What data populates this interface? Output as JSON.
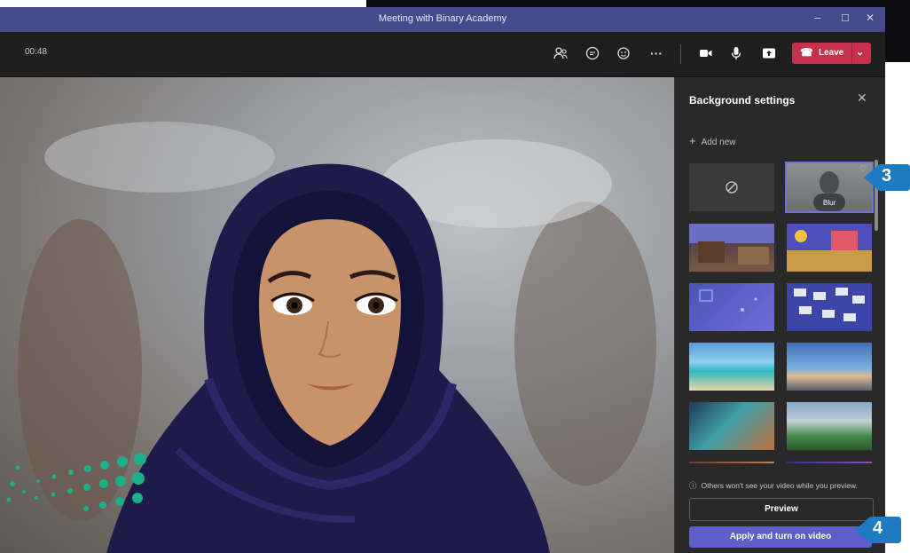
{
  "window": {
    "title": "Meeting with Binary Academy",
    "minimize": "–",
    "maximize": "☐",
    "close": "✕"
  },
  "toolbar": {
    "timer": "00:48",
    "leave_label": "Leave",
    "icons": [
      "people-icon",
      "chat-icon",
      "reactions-icon",
      "more-icon",
      "camera-icon",
      "mic-icon",
      "share-icon"
    ]
  },
  "panel": {
    "title": "Background settings",
    "add_new": "Add new",
    "blur_label": "Blur",
    "info": "Others won't see your video while you preview.",
    "preview_button": "Preview",
    "apply_button": "Apply and turn on video"
  },
  "callouts": {
    "step3": "3",
    "step4": "4"
  },
  "colors": {
    "titlebar": "#454a8c",
    "leave": "#c4314b",
    "apply": "#5b5fc7",
    "callout": "#1f7bc1"
  }
}
